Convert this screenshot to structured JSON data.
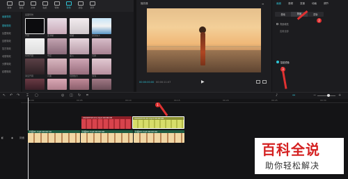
{
  "toolbar": {
    "items": [
      {
        "label": "媒体"
      },
      {
        "label": "音频"
      },
      {
        "label": "文本"
      },
      {
        "label": "贴纸"
      },
      {
        "label": "特效"
      },
      {
        "label": "转场"
      },
      {
        "label": "滤镜"
      },
      {
        "label": "调节"
      }
    ],
    "active_index": 4
  },
  "sidebar": {
    "header": "画面特效",
    "items": [
      "基础特效",
      "氛围特效",
      "边框特效",
      "复古特效",
      "动感特效",
      "分屏特效",
      "纹理特效"
    ]
  },
  "effects": {
    "section_title": "画面特效",
    "items": [
      {
        "label": "开幕"
      },
      {
        "label": "变清晰"
      },
      {
        "label": "模糊"
      },
      {
        "label": "渐渐放大"
      },
      {
        "label": "纵向开幕"
      },
      {
        "label": "雪花"
      },
      {
        "label": "星火"
      },
      {
        "label": "闪屏"
      },
      {
        "label": "渐显开幕"
      },
      {
        "label": "闪黑"
      },
      {
        "label": "轻微放大"
      },
      {
        "label": "泡泡"
      }
    ]
  },
  "player": {
    "title": "播放器",
    "time_current": "00:00:00:00",
    "time_total": "00:00:11:07"
  },
  "properties": {
    "tabs": [
      "画面",
      "音频",
      "变速",
      "动画",
      "调节"
    ],
    "active_tab": 0,
    "subtabs": [
      "基础",
      "背景",
      "蒙版"
    ],
    "active_subtab": 1,
    "section1_label": "背景填充",
    "option_label": "应用全部",
    "toggle_label": "智能镜像",
    "button_label": "应用"
  },
  "timeline": {
    "ruler": [
      "00:00",
      "00:05",
      "00:10",
      "00:15",
      "00:20",
      "00:25",
      "00:30"
    ],
    "clips_top": [
      {
        "label": "20220723-01.mp4  00:00:05",
        "color": "#c8343e"
      },
      {
        "label": "20220723-02.mp4  00:00:06",
        "color": "#c9d15a"
      }
    ],
    "clips_main": [
      {
        "label": "片段01.mp4  00:00:10"
      },
      {
        "label": "片段02.mp4  00:00:08"
      },
      {
        "label": "片段03.mp4  00:00:09"
      }
    ],
    "track_label": "封面"
  },
  "annotations": [
    "1",
    "2",
    "3"
  ],
  "watermark": {
    "title": "百科全说",
    "subtitle": "助你轻松解决"
  }
}
